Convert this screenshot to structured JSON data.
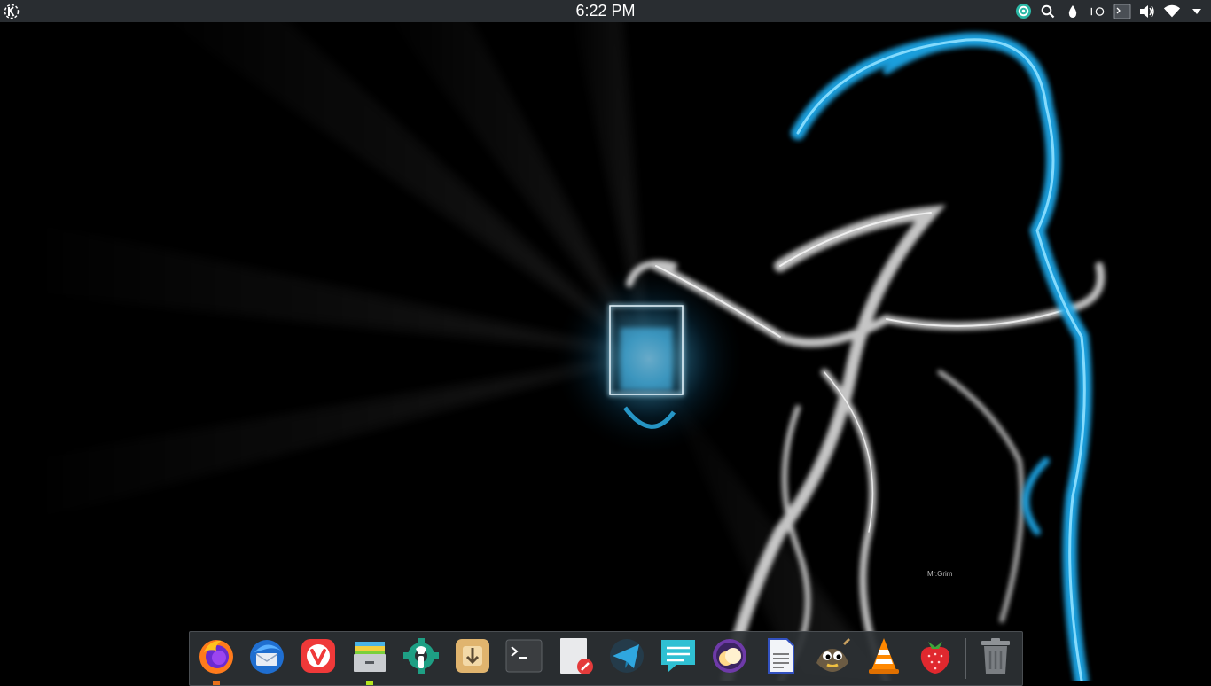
{
  "desktop": {
    "wallpaper_signature": "Mr.Grim"
  },
  "top_panel": {
    "clock": "6:22 PM",
    "launcher_icon": "kde-logo",
    "tray_icons": [
      "shutter-icon",
      "search-icon",
      "color-picker-icon",
      "circle-toggle-icon",
      "terminal-tray-icon",
      "volume-icon",
      "wifi-icon",
      "dropdown-arrow-icon"
    ]
  },
  "dock": {
    "apps": [
      {
        "name": "firefox",
        "icon": "firefox-icon",
        "running": true,
        "indicator_color": "#e8701a"
      },
      {
        "name": "thunderbird",
        "icon": "thunderbird-icon",
        "running": false
      },
      {
        "name": "vivaldi",
        "icon": "vivaldi-icon",
        "running": false
      },
      {
        "name": "file-manager",
        "icon": "archive-folder-icon",
        "running": true,
        "indicator_color": "#b5e61d"
      },
      {
        "name": "system-settings",
        "icon": "settings-gear-icon",
        "running": false
      },
      {
        "name": "software-installer",
        "icon": "installer-icon",
        "running": false
      },
      {
        "name": "terminal",
        "icon": "terminal-icon",
        "running": false
      },
      {
        "name": "text-editor",
        "icon": "text-editor-icon",
        "running": false
      },
      {
        "name": "telegram",
        "icon": "telegram-icon",
        "running": false
      },
      {
        "name": "messaging",
        "icon": "chat-icon",
        "running": false
      },
      {
        "name": "cloud-app",
        "icon": "cloud-app-icon",
        "running": false
      },
      {
        "name": "document-viewer",
        "icon": "document-icon",
        "running": false
      },
      {
        "name": "gimp",
        "icon": "gimp-icon",
        "running": false
      },
      {
        "name": "vlc",
        "icon": "vlc-icon",
        "running": false
      },
      {
        "name": "raspberry",
        "icon": "strawberry-icon",
        "running": false
      },
      {
        "name": "trash",
        "icon": "trash-icon",
        "running": false
      }
    ]
  },
  "colors": {
    "panel_bg": "#292d31",
    "dock_bg": "#2c3034",
    "accent_blue": "#1fa7e8",
    "smoke_white": "#e6e6e6"
  }
}
